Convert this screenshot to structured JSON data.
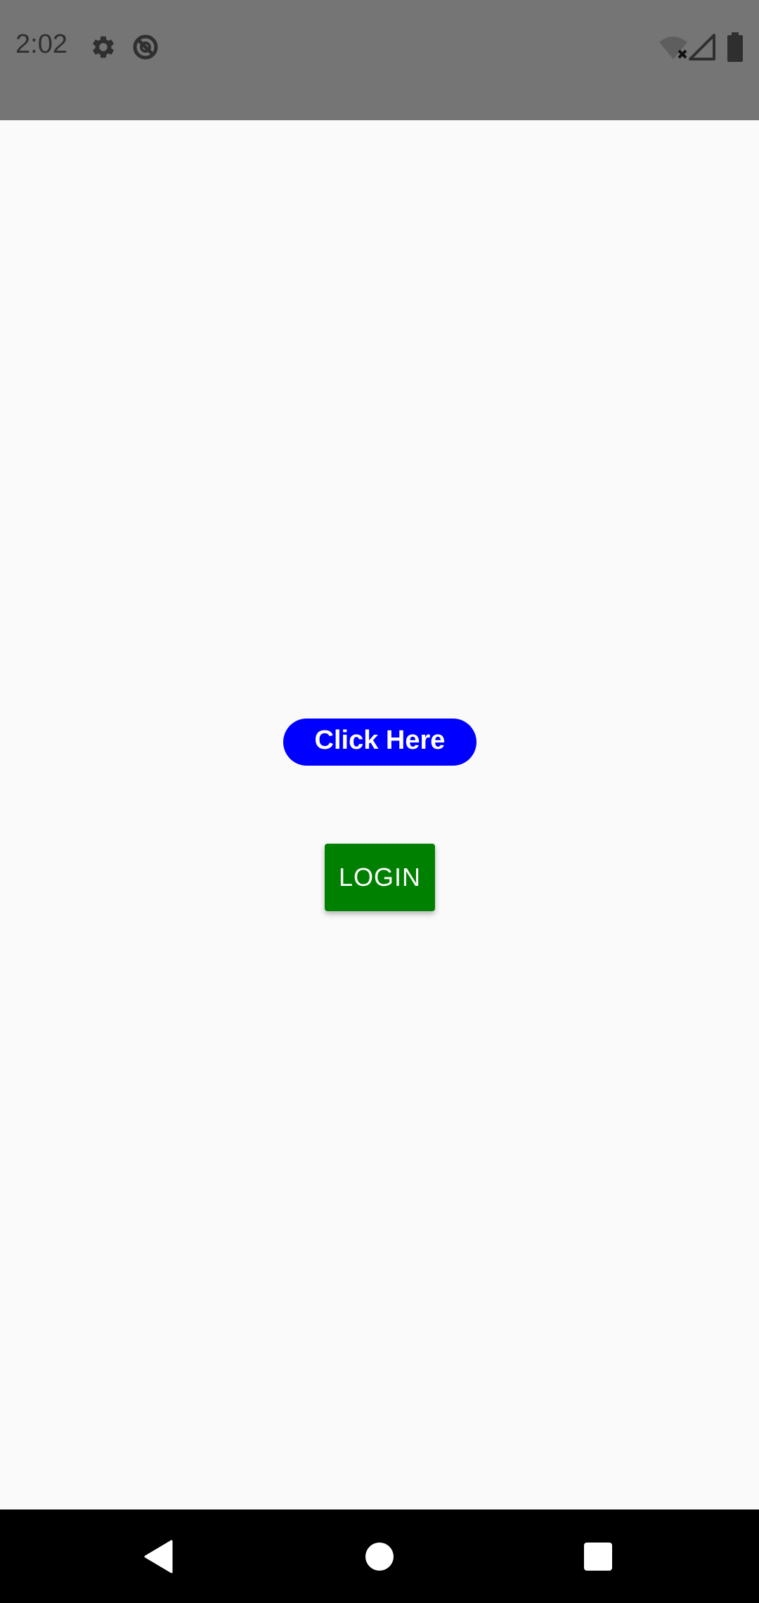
{
  "status_bar": {
    "time": "2:02",
    "icons": [
      "gear-icon",
      "no-disturb-icon",
      "wifi-off-icon",
      "cellular-signal-icon",
      "battery-icon"
    ],
    "background_color": "#757575"
  },
  "main": {
    "click_here_label": "Click Here",
    "click_here_color": "#0000ff",
    "login_label": "LOGIN",
    "login_color": "#008000"
  },
  "nav_bar": {
    "buttons": [
      "back-icon",
      "home-icon",
      "recents-icon"
    ],
    "background_color": "#000000"
  }
}
